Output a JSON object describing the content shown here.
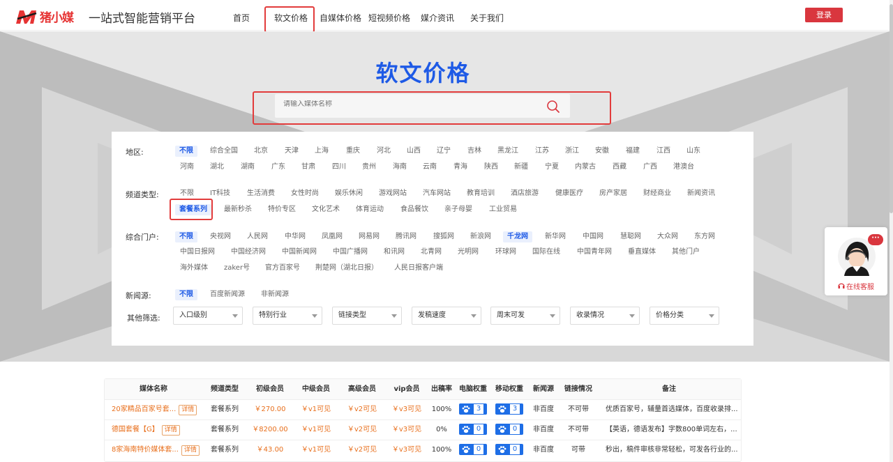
{
  "header": {
    "logo_text": "猪小媒",
    "slogan": "一站式智能营销平台",
    "nav": [
      "首页",
      "软文价格",
      "自媒体价格",
      "短视频价格",
      "媒介资讯",
      "关于我们"
    ],
    "login": "登录"
  },
  "hero": {
    "title": "软文价格",
    "search_placeholder": "请输入媒体名称"
  },
  "filters": {
    "region": {
      "label": "地区:",
      "row1": [
        "不限",
        "综合全国",
        "北京",
        "天津",
        "上海",
        "重庆",
        "河北",
        "山西",
        "辽宁",
        "吉林",
        "黑龙江",
        "江苏",
        "浙江",
        "安徽",
        "福建",
        "江西",
        "山东"
      ],
      "row2": [
        "河南",
        "湖北",
        "湖南",
        "广东",
        "甘肃",
        "四川",
        "贵州",
        "海南",
        "云南",
        "青海",
        "陕西",
        "新疆",
        "宁夏",
        "内蒙古",
        "西藏",
        "广西",
        "港澳台"
      ]
    },
    "channel": {
      "label": "频道类型:",
      "row1": [
        "不限",
        "IT科技",
        "生活消费",
        "女性时尚",
        "娱乐休闲",
        "游戏网站",
        "汽车网站",
        "教育培训",
        "酒店旅游",
        "健康医疗",
        "房产家居",
        "财经商业",
        "新闻资讯"
      ],
      "row2": [
        "套餐系列",
        "最新秒杀",
        "特价专区",
        "文化艺术",
        "体育运动",
        "食品餐饮",
        "亲子母婴",
        "工业贸易"
      ]
    },
    "portal": {
      "label": "综合门户:",
      "row1": [
        "不限",
        "央视网",
        "人民网",
        "中华网",
        "凤凰网",
        "网易网",
        "腾讯网",
        "搜狐网",
        "新浪网",
        "千龙网",
        "新华网",
        "中国网",
        "慧聪网",
        "大众网",
        "东方网"
      ],
      "row2": [
        "中国日报网",
        "中国经济网",
        "中国新闻网",
        "中国广播网",
        "和讯网",
        "北青网",
        "光明网",
        "环球网",
        "国际在线",
        "中国青年网",
        "垂直媒体",
        "其他门户"
      ],
      "row3": [
        "海外媒体",
        "zaker号",
        "官方百家号",
        "荆楚网（湖北日报）",
        "人民日报客户端"
      ]
    },
    "news_source": {
      "label": "新闻源:",
      "items": [
        "不限",
        "百度新闻源",
        "非新闻源"
      ]
    },
    "other": {
      "label": "其他筛选:",
      "selects": [
        "入口级别",
        "特别行业",
        "链接类型",
        "发稿速度",
        "周末可发",
        "收录情况",
        "价格分类"
      ]
    }
  },
  "table": {
    "headers": [
      "媒体名称",
      "频道类型",
      "初级会员",
      "中级会员",
      "高级会员",
      "vip会员",
      "出稿率",
      "电脑权重",
      "移动权重",
      "新闻源",
      "链接情况",
      "备注"
    ],
    "detail_label": "详情",
    "rows": [
      {
        "name": "20家精品百家号套...",
        "type": "套餐系列",
        "junior": "￥270.00",
        "mid": "￥v1可见",
        "senior": "￥v2可见",
        "vip": "￥v3可见",
        "rate": "100%",
        "pc": "3",
        "mobile": "3",
        "source": "非百度",
        "link": "不可带",
        "note": "优质百家号，辅量首选媒体，百度收录排..."
      },
      {
        "name": "德国套餐【G】",
        "type": "套餐系列",
        "junior": "￥8200.00",
        "mid": "￥v1可见",
        "senior": "￥v2可见",
        "vip": "￥v3可见",
        "rate": "0%",
        "pc": "0",
        "mobile": "0",
        "source": "非百度",
        "link": "不可带",
        "note": "【英语，德语发布】字数800单词左右，..."
      },
      {
        "name": "8家海南特价媒体套...",
        "type": "套餐系列",
        "junior": "￥43.00",
        "mid": "￥v1可见",
        "senior": "￥v2可见",
        "vip": "￥v3可见",
        "rate": "100%",
        "pc": "0",
        "mobile": "0",
        "source": "非百度",
        "link": "可带",
        "note": "秒出，稿件审核非常轻松，可发各行业的..."
      }
    ]
  },
  "service": {
    "label": "在线客服",
    "bubble": "···"
  },
  "colors": {
    "brand_blue": "#1e5ae6",
    "brand_red": "#d9363e",
    "price_orange": "#e86f1c",
    "highlight_box": "#e23b3b"
  }
}
